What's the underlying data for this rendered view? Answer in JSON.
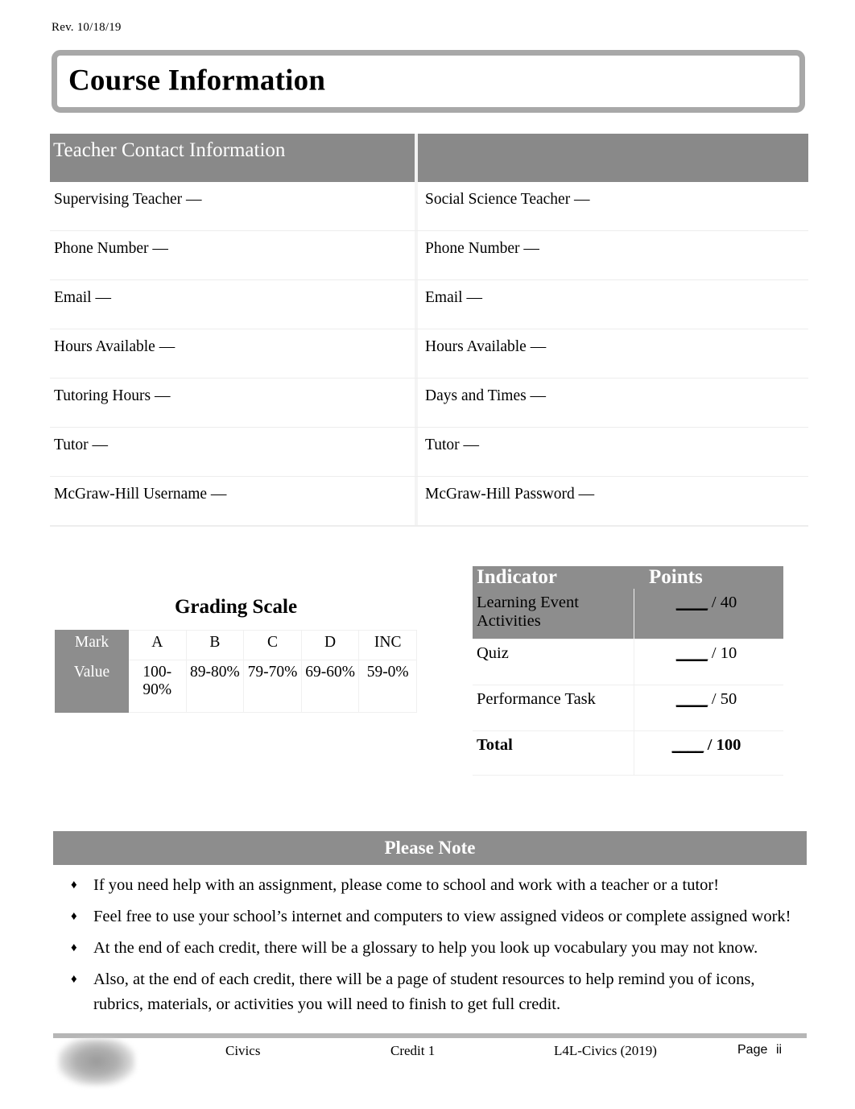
{
  "revision": "Rev. 10/18/19",
  "title": "Course Information",
  "contact": {
    "header_left": "Teacher Contact Information",
    "header_right": "",
    "rows": [
      {
        "left": "Supervising Teacher —",
        "right": "Social Science Teacher —"
      },
      {
        "left": "Phone Number —",
        "right": "Phone Number —"
      },
      {
        "left": "Email —",
        "right": "Email —"
      },
      {
        "left": "Hours Available —",
        "right": "Hours Available —"
      },
      {
        "left": "Tutoring Hours —",
        "right": "Days and Times —"
      },
      {
        "left": "Tutor —",
        "right": "Tutor —"
      },
      {
        "left": "McGraw-Hill Username —",
        "right": "McGraw-Hill Password —"
      }
    ]
  },
  "grading": {
    "title": "Grading Scale",
    "row_labels": [
      "Mark",
      "Value"
    ],
    "marks": [
      "A",
      "B",
      "C",
      "D",
      "INC"
    ],
    "values": [
      "100-90%",
      "89-80%",
      "79-70%",
      "69-60%",
      "59-0%"
    ]
  },
  "indicator": {
    "header_indicator": "Indicator",
    "header_points": "Points",
    "rows": [
      {
        "indicator": "Learning Event Activities",
        "blank": "____",
        "points": "/ 40"
      },
      {
        "indicator": "Quiz",
        "blank": "____",
        "points": "/ 10"
      },
      {
        "indicator": "Performance Task",
        "blank": "____",
        "points": "/ 50"
      },
      {
        "indicator": "Total",
        "blank": "____",
        "points": "/ 100"
      }
    ]
  },
  "note": {
    "header": "Please Note",
    "bullet_glyph": "♦",
    "items": [
      "If you need help with an assignment, please come to school and work with a teacher or a tutor!",
      "Feel free to use your school’s internet and computers to view assigned videos or complete assigned work!",
      "At the end of each credit, there will be a glossary to help you look up vocabulary you may not know.",
      "Also, at the end of each credit, there will be a page of student resources to help remind you of icons, rubrics, materials, or activities you will need to finish to get full credit."
    ]
  },
  "footer": {
    "subject": "Civics",
    "credit": "Credit 1",
    "source": "L4L-Civics (2019)",
    "page_label": "Page",
    "page_number": "ii"
  },
  "colors": {
    "band_gray": "#8d8d8d",
    "border_gray": "#a8a8a8",
    "rule_gray": "#b6b6b6"
  }
}
